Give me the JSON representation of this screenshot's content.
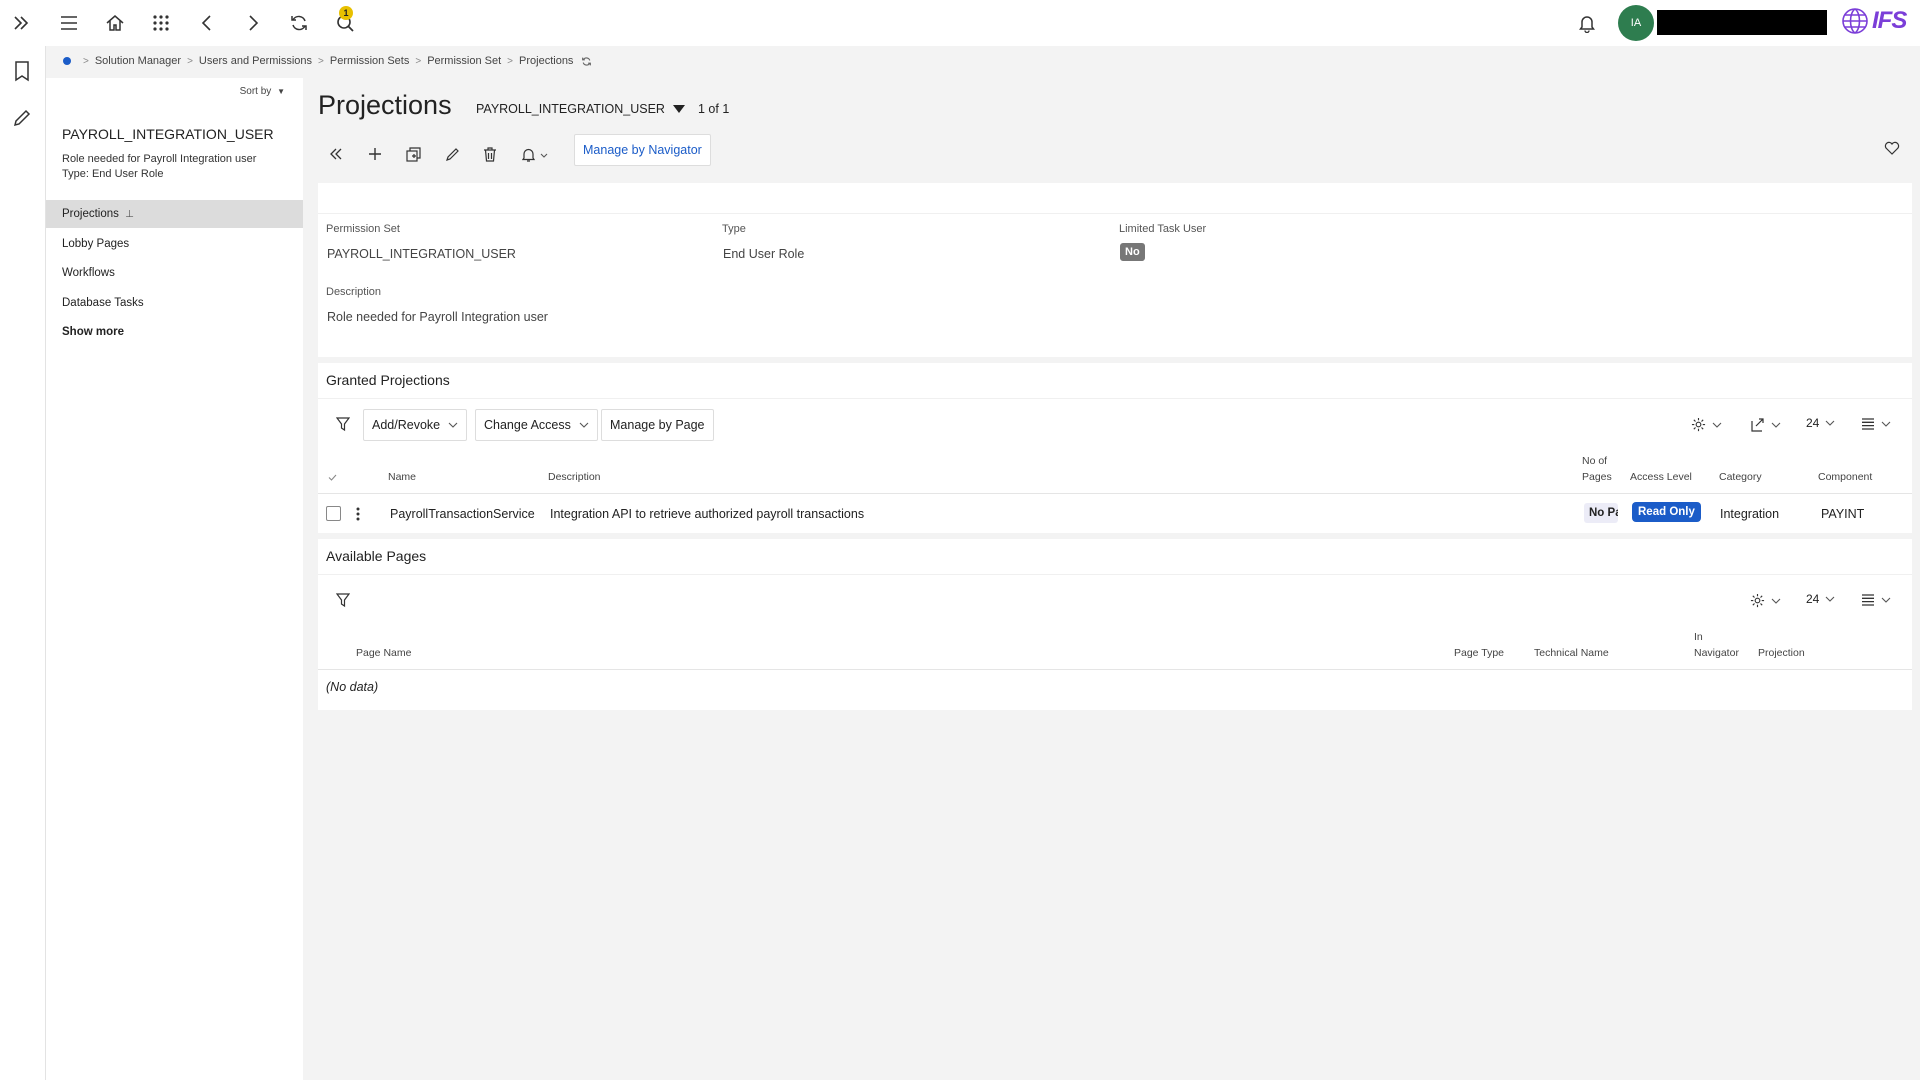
{
  "topbar": {
    "notification_count": "1",
    "avatar_initials": "IA",
    "logo_text": "IFS"
  },
  "breadcrumb": [
    "Solution Manager",
    "Users and Permissions",
    "Permission Sets",
    "Permission Set",
    "Projections"
  ],
  "side": {
    "sort_label": "Sort by",
    "title": "PAYROLL_INTEGRATION_USER",
    "description": "Role needed for Payroll Integration user",
    "type_line": "Type:   End User Role",
    "items": [
      {
        "label": "Projections"
      },
      {
        "label": "Lobby Pages"
      },
      {
        "label": "Workflows"
      },
      {
        "label": "Database Tasks"
      }
    ],
    "show_more": "Show more"
  },
  "header": {
    "title": "Projections",
    "selected_record": "PAYROLL_INTEGRATION_USER",
    "record_count": "1 of 1",
    "manage_navigator": "Manage by Navigator"
  },
  "details": {
    "permission_set_label": "Permission Set",
    "permission_set_value": "PAYROLL_INTEGRATION_USER",
    "type_label": "Type",
    "type_value": "End User Role",
    "limited_label": "Limited Task User",
    "limited_value": "No",
    "description_label": "Description",
    "description_value": "Role needed for Payroll Integration user"
  },
  "granted": {
    "title": "Granted Projections",
    "add_revoke": "Add/Revoke",
    "change_access": "Change Access",
    "manage_by_page": "Manage by Page",
    "page_size": "24",
    "columns": {
      "name": "Name",
      "description": "Description",
      "no_of_pages_1": "No of",
      "no_of_pages_2": "Pages",
      "access_level": "Access Level",
      "category": "Category",
      "component": "Component"
    },
    "rows": [
      {
        "name": "PayrollTransactionService",
        "description": "Integration API to retrieve authorized payroll transactions",
        "no_of_pages": "No Pages",
        "access_level": "Read Only",
        "category": "Integration",
        "component": "PAYINT"
      }
    ]
  },
  "available": {
    "title": "Available Pages",
    "page_size": "24",
    "columns": {
      "page_name": "Page Name",
      "page_type": "Page Type",
      "technical_name": "Technical Name",
      "in_navigator_1": "In",
      "in_navigator_2": "Navigator",
      "projection": "Projection"
    },
    "empty": "(No data)"
  }
}
